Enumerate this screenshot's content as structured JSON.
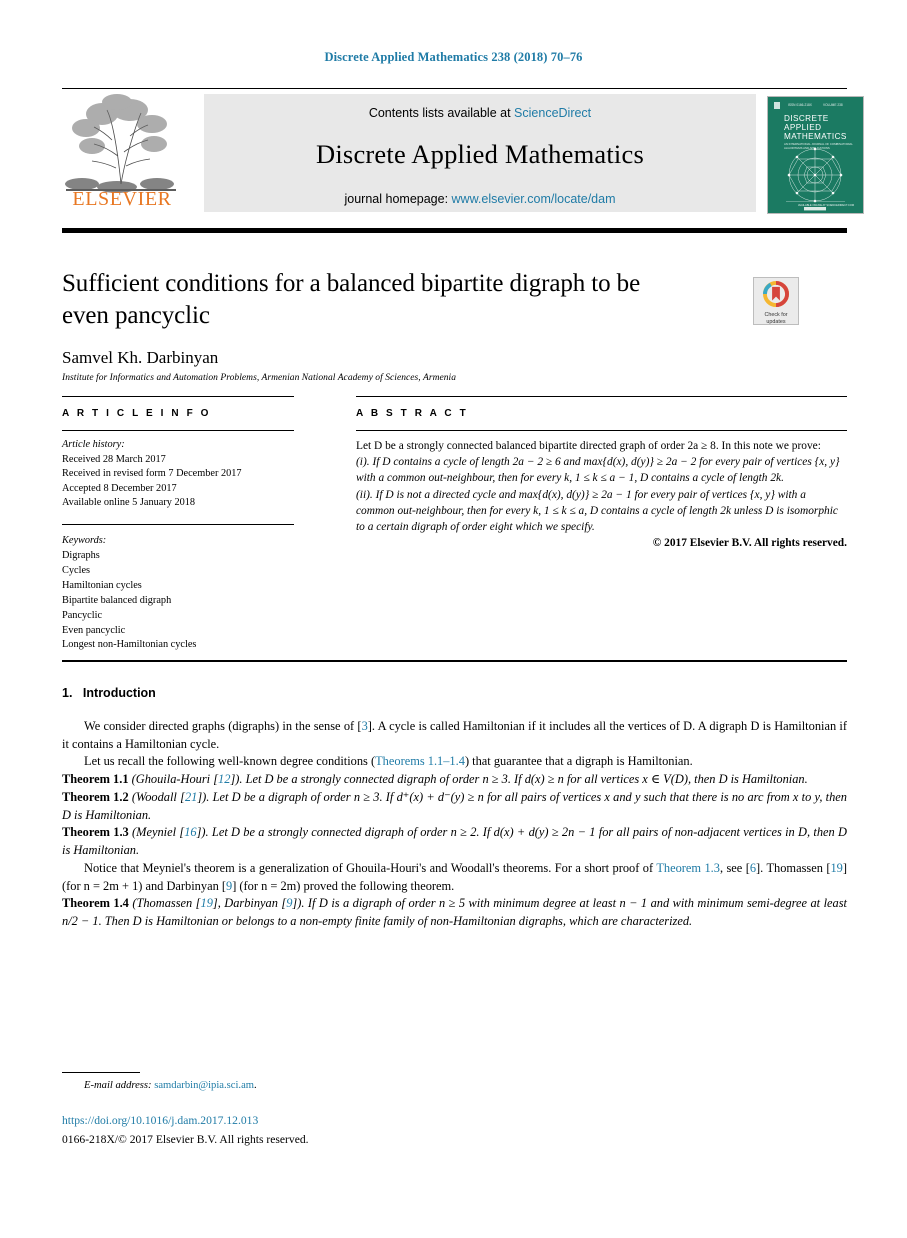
{
  "running_head": "Discrete Applied Mathematics 238 (2018) 70–76",
  "masthead": {
    "contents_prefix": "Contents lists available at",
    "contents_link": "ScienceDirect",
    "journal_name": "Discrete Applied Mathematics",
    "homepage_prefix": "journal homepage:",
    "homepage_link": "www.elsevier.com/locate/dam",
    "publisher_logo_text": "ELSEVIER",
    "cover_title_lines": [
      "DISCRETE",
      "APPLIED",
      "MATHEMATICS"
    ],
    "accent_link_color": "#1f7ba6",
    "elsevier_orange": "#E87722",
    "cover_green": "#1b7a62"
  },
  "article": {
    "title": "Sufficient conditions for a balanced bipartite digraph to be even pancyclic",
    "author": "Samvel Kh. Darbinyan",
    "affiliation": "Institute for Informatics and Automation Problems, Armenian National Academy of Sciences, Armenia",
    "crossmark_line1": "Check for",
    "crossmark_line2": "updates"
  },
  "info": {
    "heading": "A R T I C L E    I N F O",
    "history_label": "Article history:",
    "history": [
      "Received 28 March 2017",
      "Received in revised form 7 December 2017",
      "Accepted 8 December 2017",
      "Available online 5 January 2018"
    ],
    "keywords_label": "Keywords:",
    "keywords": [
      "Digraphs",
      "Cycles",
      "Hamiltonian cycles",
      "Bipartite balanced digraph",
      "Pancyclic",
      "Even pancyclic",
      "Longest non-Hamiltonian cycles"
    ]
  },
  "abstract": {
    "heading": "A B S T R A C T",
    "p1": "Let D be a strongly connected balanced bipartite directed graph of order 2a ≥ 8. In this note we prove:",
    "p2": "(i). If D contains a cycle of length 2a − 2 ≥ 6 and max{d(x), d(y)} ≥ 2a − 2 for every pair of vertices {x, y} with a common out-neighbour, then for every k, 1 ≤ k ≤ a − 1, D contains a cycle of length 2k.",
    "p3": "(ii). If D is not a directed cycle and max{d(x), d(y)} ≥ 2a − 1 for every pair of vertices {x, y} with a common out-neighbour, then for every k, 1 ≤ k ≤ a, D contains a cycle of length 2k unless D is isomorphic to a certain digraph of order eight which we specify.",
    "copyright": "© 2017 Elsevier B.V. All rights reserved."
  },
  "body": {
    "section_number": "1.",
    "section_title": "Introduction",
    "para1_a": "We consider directed graphs (digraphs) in the sense of [",
    "para1_ref": "3",
    "para1_b": "]. A cycle is called Hamiltonian if it includes all the vertices of D. A digraph D is Hamiltonian if it contains a Hamiltonian cycle.",
    "para2_a": "Let us recall the following well-known degree conditions (",
    "para2_ref": "Theorems 1.1–1.4",
    "para2_b": ") that guarantee that a digraph is Hamiltonian.",
    "theorems": [
      {
        "name": "Theorem 1.1",
        "attr_pre": " (Ghouila-Houri [",
        "attr_ref": "12",
        "attr_post": "]).",
        "text": "  Let D be a strongly connected digraph of order n ≥ 3. If d(x) ≥ n for all vertices x ∈ V(D), then D is Hamiltonian."
      },
      {
        "name": "Theorem 1.2",
        "attr_pre": " (Woodall [",
        "attr_ref": "21",
        "attr_post": "]).",
        "text": "  Let D be a digraph of order n ≥ 3. If d⁺(x) + d⁻(y) ≥ n for all pairs of vertices x and y such that there is no arc from x to y, then D is Hamiltonian."
      },
      {
        "name": "Theorem 1.3",
        "attr_pre": " (Meyniel [",
        "attr_ref": "16",
        "attr_post": "]).",
        "text": "  Let D be a strongly connected digraph of order n ≥ 2. If d(x) + d(y) ≥ 2n − 1 for all pairs of non-adjacent vertices in D, then D is Hamiltonian."
      }
    ],
    "para3_a": "Notice that Meyniel's theorem is a generalization of Ghouila-Houri's and Woodall's theorems. For a short proof of ",
    "para3_ref1": "Theorem 1.3",
    "para3_b": ", see [",
    "para3_ref2": "6",
    "para3_c": "]. Thomassen [",
    "para3_ref3": "19",
    "para3_d": "] (for n = 2m + 1) and Darbinyan [",
    "para3_ref4": "9",
    "para3_e": "] (for n = 2m) proved the following theorem.",
    "theorem4": {
      "name": "Theorem 1.4",
      "attr_pre": " (Thomassen [",
      "attr_ref1": "19",
      "attr_mid": "], Darbinyan [",
      "attr_ref2": "9",
      "attr_post": "]).",
      "text": "  If D is a digraph of order n ≥ 5 with minimum degree at least n − 1 and with minimum semi-degree at least n/2 − 1. Then D is Hamiltonian or belongs to a non-empty finite family of non-Hamiltonian digraphs, which are characterized."
    }
  },
  "footer": {
    "email_label": "E-mail address:",
    "email": "samdarbin@ipia.sci.am",
    "email_suffix": ".",
    "doi": "https://doi.org/10.1016/j.dam.2017.12.013",
    "issn_line": "0166-218X/© 2017 Elsevier B.V. All rights reserved."
  }
}
